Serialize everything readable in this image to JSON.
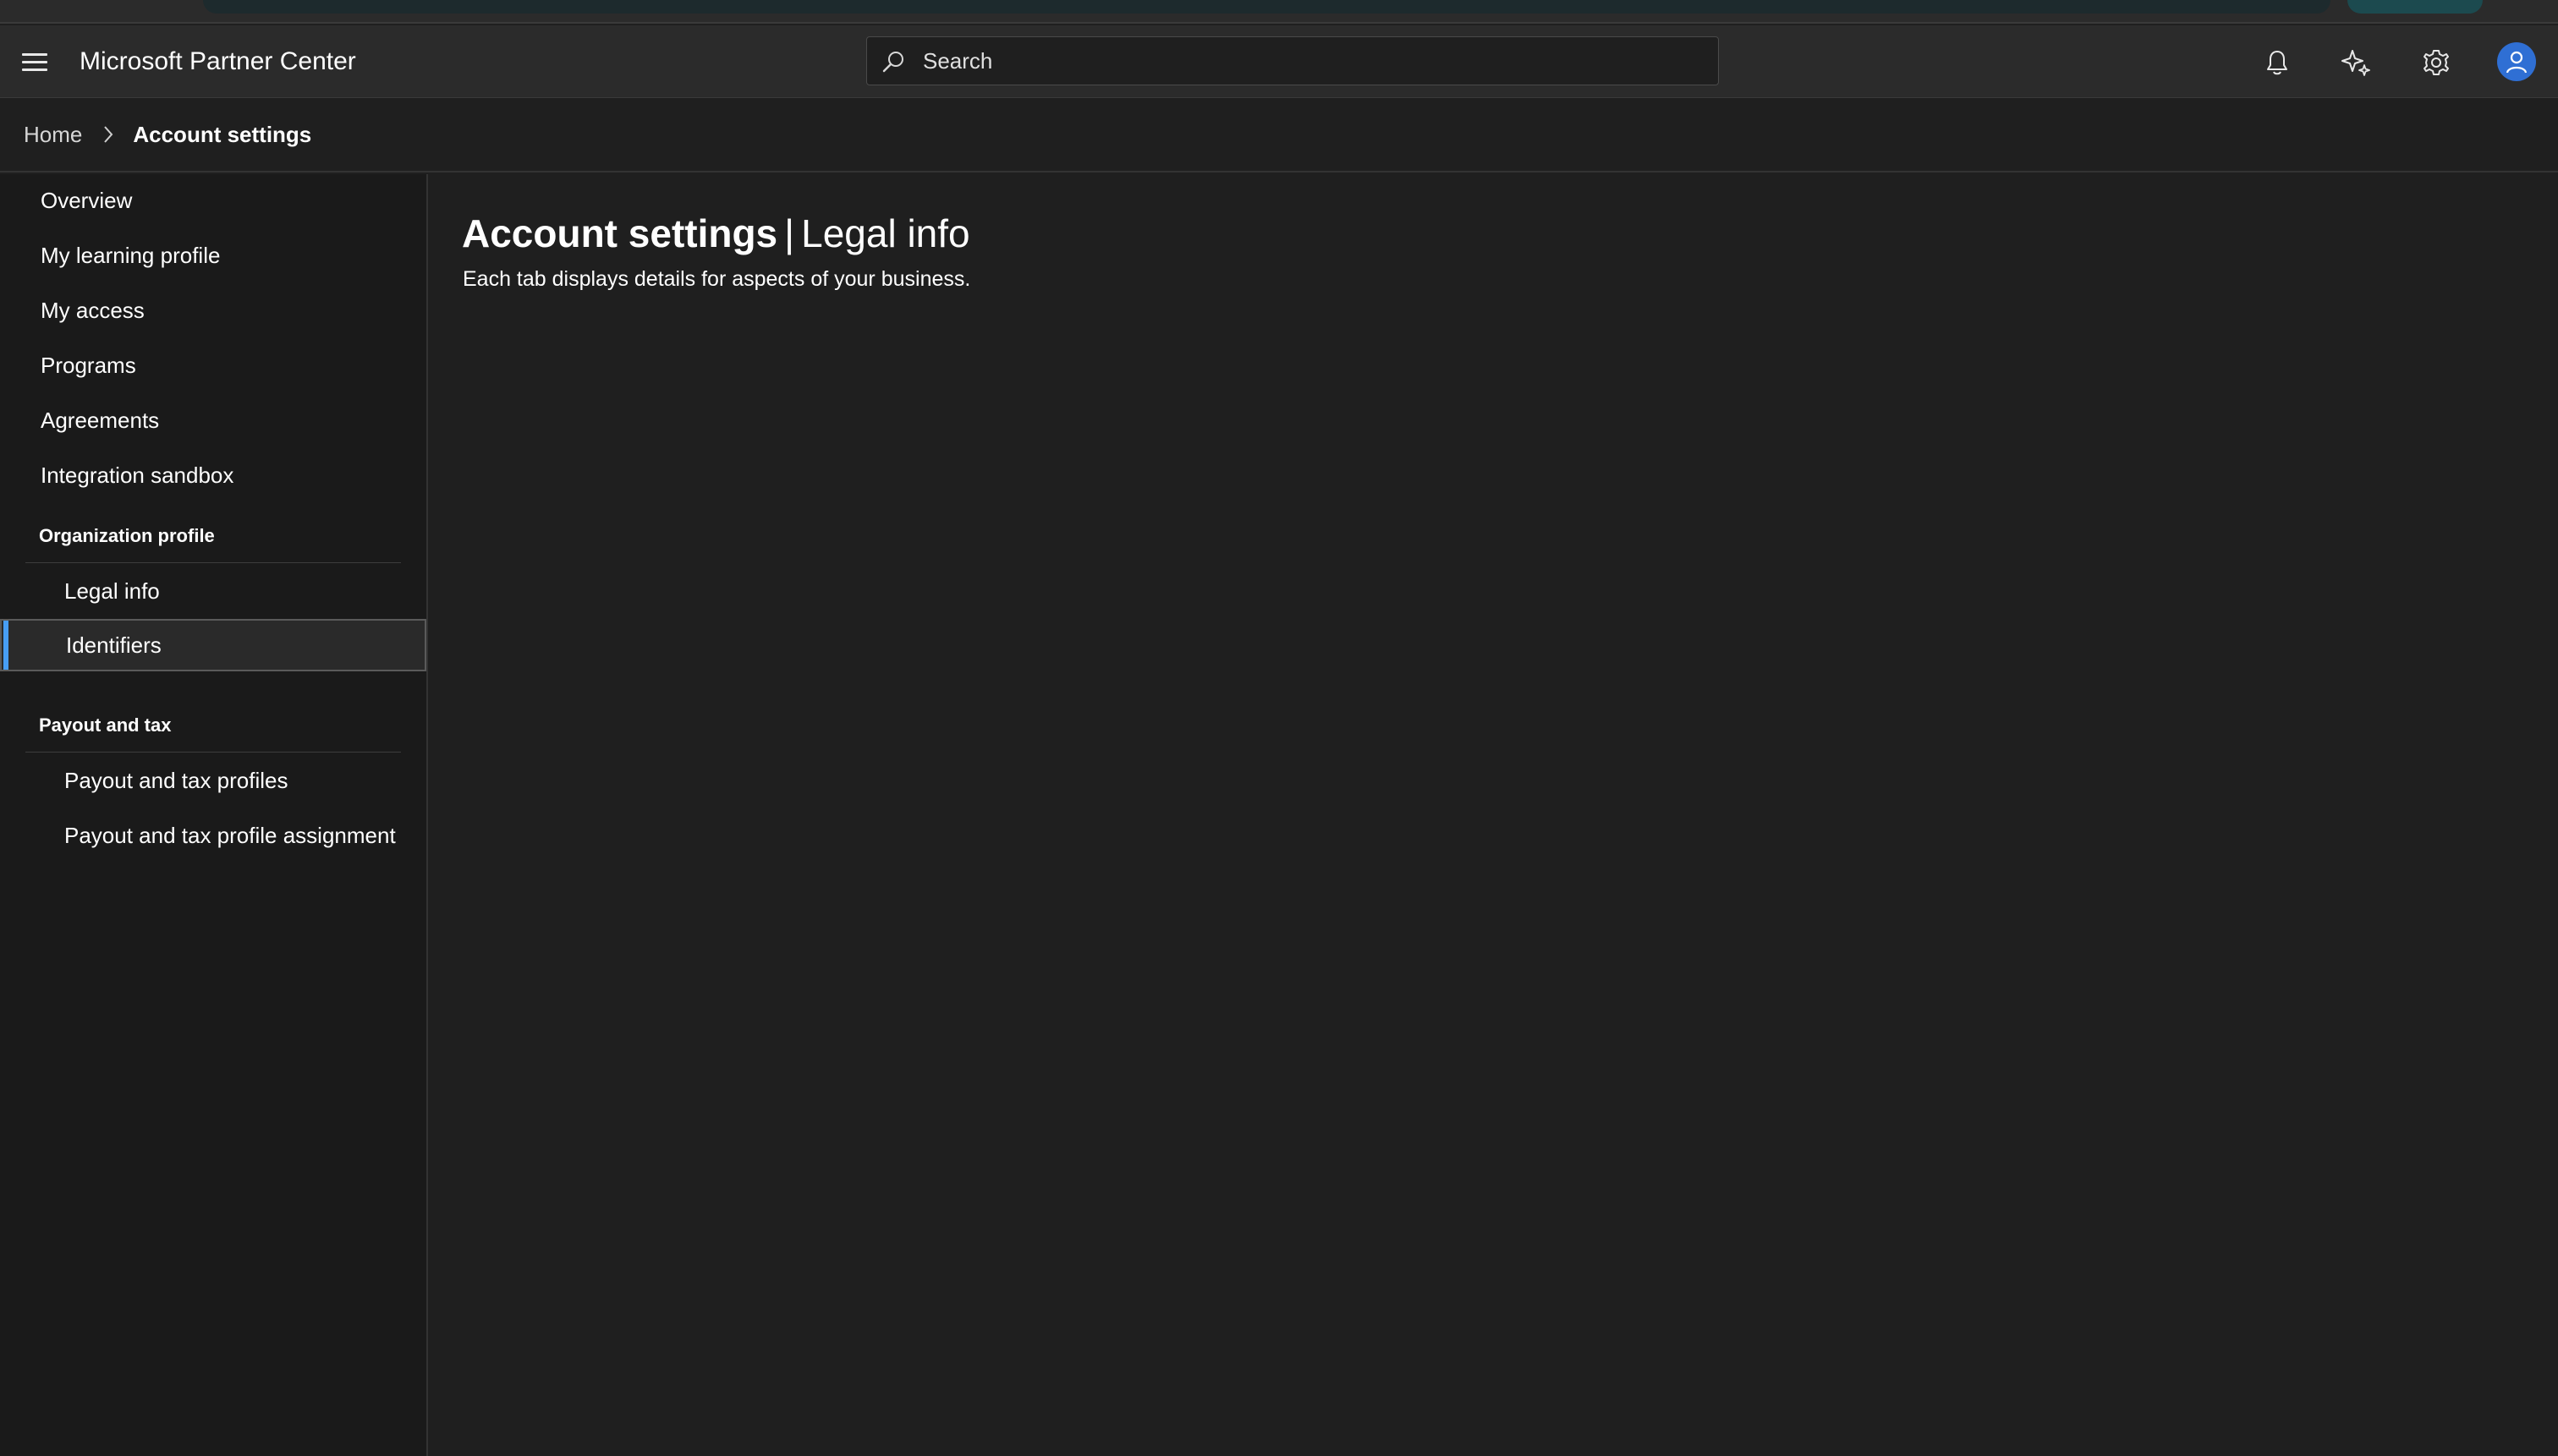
{
  "header": {
    "app_title": "Microsoft Partner Center",
    "search_placeholder": "Search"
  },
  "breadcrumb": {
    "home": "Home",
    "current": "Account settings"
  },
  "sidebar": {
    "items": [
      {
        "label": "Overview"
      },
      {
        "label": "My learning profile"
      },
      {
        "label": "My access"
      },
      {
        "label": "Programs"
      },
      {
        "label": "Agreements"
      },
      {
        "label": "Integration sandbox"
      }
    ],
    "sections": [
      {
        "title": "Organization profile",
        "items": [
          {
            "label": "Legal info"
          },
          {
            "label": "Identifiers",
            "selected": true
          }
        ]
      },
      {
        "title": "Payout and tax",
        "items": [
          {
            "label": "Payout and tax profiles"
          },
          {
            "label": "Payout and tax profile assignment"
          }
        ]
      }
    ]
  },
  "main": {
    "title": "Account settings",
    "separator": "|",
    "subtitle": "Legal info",
    "description": "Each tab displays details for aspects of your business."
  },
  "colors": {
    "accent": "#479ef5",
    "avatar": "#2f6fd4",
    "background": "#1f1f1f",
    "sidebar": "#1a1a1a",
    "topbar": "#2b2b2b"
  }
}
